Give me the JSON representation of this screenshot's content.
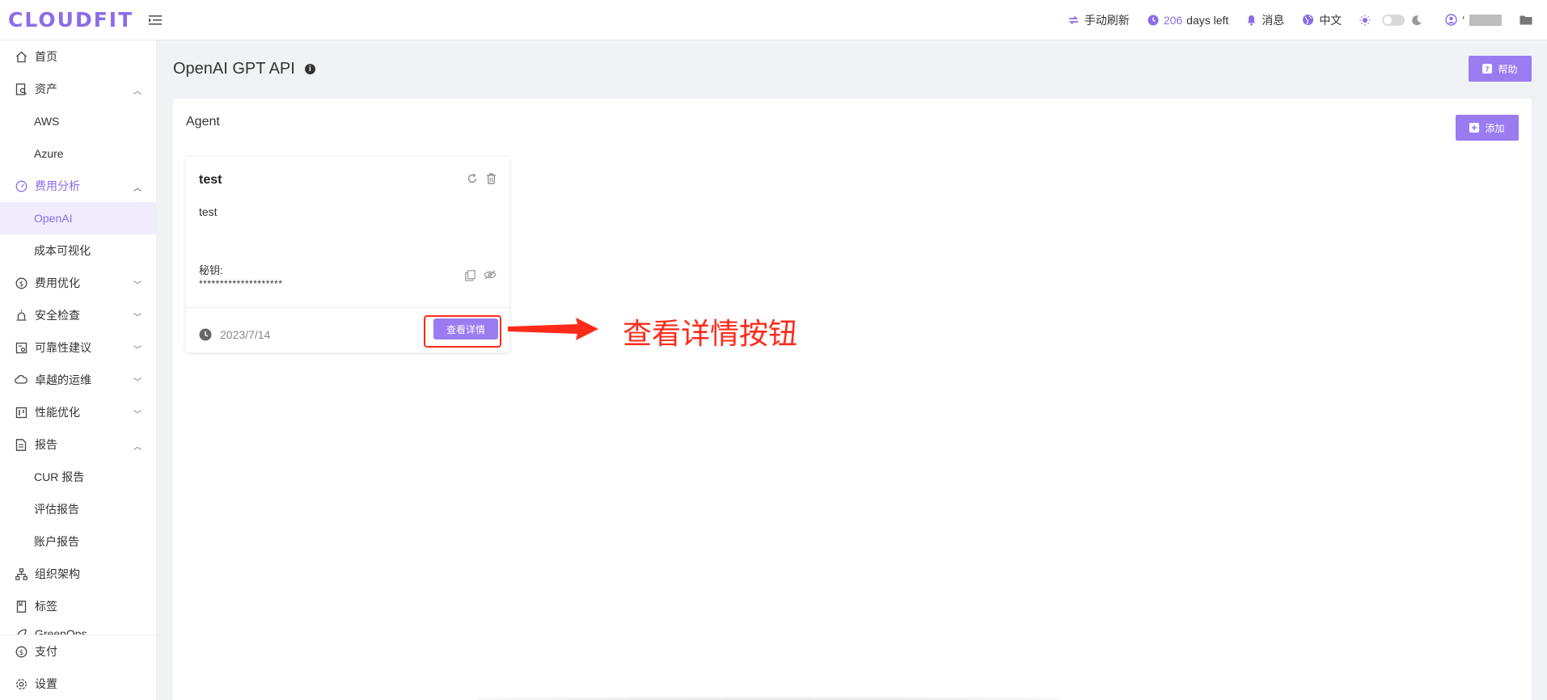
{
  "brand": {
    "logo": "CLOUDFIT",
    "accent": "#8a6de9"
  },
  "header": {
    "refresh_label": "手动刷新",
    "days_number": "206",
    "days_suffix": "days left",
    "messages_label": "消息",
    "language_label": "中文",
    "user_initial": "'"
  },
  "sidebar": {
    "items": [
      {
        "label": "首页",
        "icon": "home-icon"
      },
      {
        "label": "资产",
        "icon": "asset-icon",
        "chevron": "up"
      },
      {
        "label": "AWS"
      },
      {
        "label": "Azure"
      },
      {
        "label": "费用分析",
        "icon": "dashboard-icon",
        "chevron": "up"
      },
      {
        "label": "OpenAI"
      },
      {
        "label": "成本可视化"
      },
      {
        "label": "费用优化",
        "icon": "dollar-icon",
        "chevron": "down"
      },
      {
        "label": "安全检查",
        "icon": "alarm-icon",
        "chevron": "down"
      },
      {
        "label": "可靠性建议",
        "icon": "reliability-icon",
        "chevron": "down"
      },
      {
        "label": "卓越的运维",
        "icon": "cloud-icon",
        "chevron": "down"
      },
      {
        "label": "性能优化",
        "icon": "performance-icon",
        "chevron": "down"
      },
      {
        "label": "报告",
        "icon": "report-icon",
        "chevron": "up"
      },
      {
        "label": "CUR 报告"
      },
      {
        "label": "评估报告"
      },
      {
        "label": "账户报告"
      },
      {
        "label": "组织架构",
        "icon": "org-icon"
      },
      {
        "label": "标签",
        "icon": "tag-icon"
      },
      {
        "label": "GreenOps",
        "icon": "leaf-icon"
      }
    ],
    "bottom": [
      {
        "label": "支付",
        "icon": "dollar-icon"
      },
      {
        "label": "设置",
        "icon": "gear-icon"
      }
    ]
  },
  "page": {
    "title": "OpenAI GPT API",
    "help_label": "帮助",
    "section_title": "Agent",
    "add_label": "添加"
  },
  "card": {
    "name": "test",
    "description": "test",
    "key_label": "秘钥:",
    "key_value": "********************",
    "date": "2023/7/14",
    "detail_label": "查看详情"
  },
  "annotation": {
    "text": "查看详情按钮",
    "color": "#ff2a1a"
  }
}
